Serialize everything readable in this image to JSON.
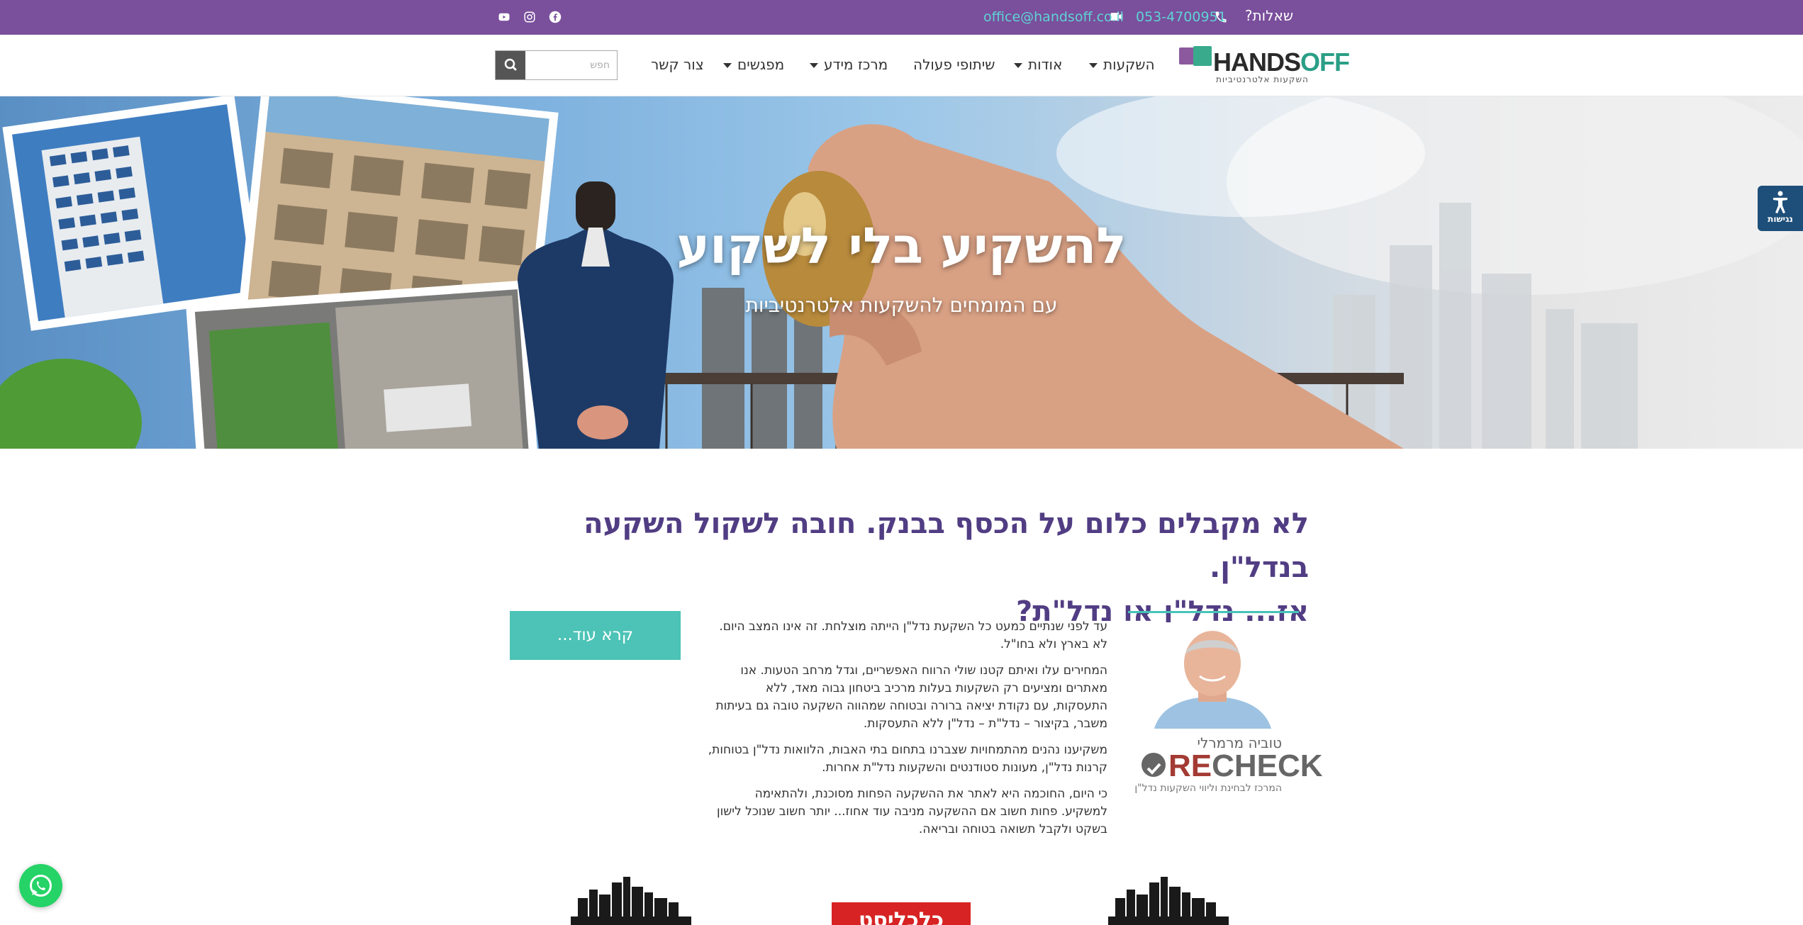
{
  "topbar": {
    "ask_label": "שאלות?",
    "phone": "053-4700951",
    "email": "office@handsoff.co.il",
    "social": [
      "facebook-icon",
      "instagram-icon",
      "youtube-icon"
    ],
    "background": "#7a4f9c",
    "link_color": "#5fd3d3"
  },
  "header": {
    "logo": {
      "word_dark": "HANDS",
      "word_accent": "OFF",
      "tagline": "השקעות אלטרנטיביות"
    },
    "nav": [
      {
        "label": "השקעות",
        "dropdown": true
      },
      {
        "label": "אודות",
        "dropdown": true
      },
      {
        "label": "שיתופי פעולה",
        "dropdown": false
      },
      {
        "label": "מרכז מידע",
        "dropdown": true
      },
      {
        "label": "מפגשים",
        "dropdown": true
      },
      {
        "label": "צור קשר",
        "dropdown": false
      }
    ],
    "search": {
      "placeholder": "חפש",
      "value": ""
    }
  },
  "hero": {
    "title": "להשקיע בלי לשקוע",
    "subtitle": "עם המומחים להשקעות אלטרנטיביות"
  },
  "accessibility": {
    "label": "נגישות",
    "color": "#1e4f7a"
  },
  "main": {
    "headline_line1": "לא מקבלים כלום על הכסף בבנק. חובה לשקול השקעה בנדל\"ן.",
    "headline_line2": "אז... נדל\"ן או נדל\"ת?",
    "headline_color": "#513d83",
    "paragraphs": [
      "עד לפני שנתיים כמעט כל השקעת נדל\"ן הייתה מוצלחת. זה אינו המצב היום. לא בארץ ולא בחו\"ל.",
      "המחירים עלו ואיתם קטנו שולי הרווח האפשריים, וגדל מרחב הטעות. אנו מאתרים ומציעים רק השקעות בעלות מרכיב ביטחון גבוה מאד, ללא התעסקות, עם נקודת יציאה ברורה ובטוחה שמהווה השקעה טובה גם בעיתות משבר, בקיצור – נדל\"ת – נדל\"ן ללא התעסקות.",
      "משקיענו נהנים מהתמחויות שצברנו בתחום בתי האבות, הלוואות נדל\"ן בטוחות, קרנות נדל\"ן, מעונות סטודנטים והשקעות נדל\"ת אחרות.",
      "כי היום, החוכמה היא לאתר את ההשקעה הפחות מסוכנת, ולהתאימה למשקיע. פחות חשוב אם ההשקעה מניבה עוד אחוז... יותר חשוב שנוכל לישון בשקט ולקבל תשואה בטוחה ובריאה."
    ],
    "read_more_label": "קרא עוד...",
    "accent_color": "#4cc3b6",
    "profile": {
      "name": "טוביה מרמרלי",
      "brand_prefix": "RE",
      "brand_suffix": "CHECK",
      "brand_sub": "המרכז לבחינת וליווי השקעות נדל\"ן"
    }
  },
  "bottom_logos": {
    "middle_label": "כלכליסט"
  }
}
